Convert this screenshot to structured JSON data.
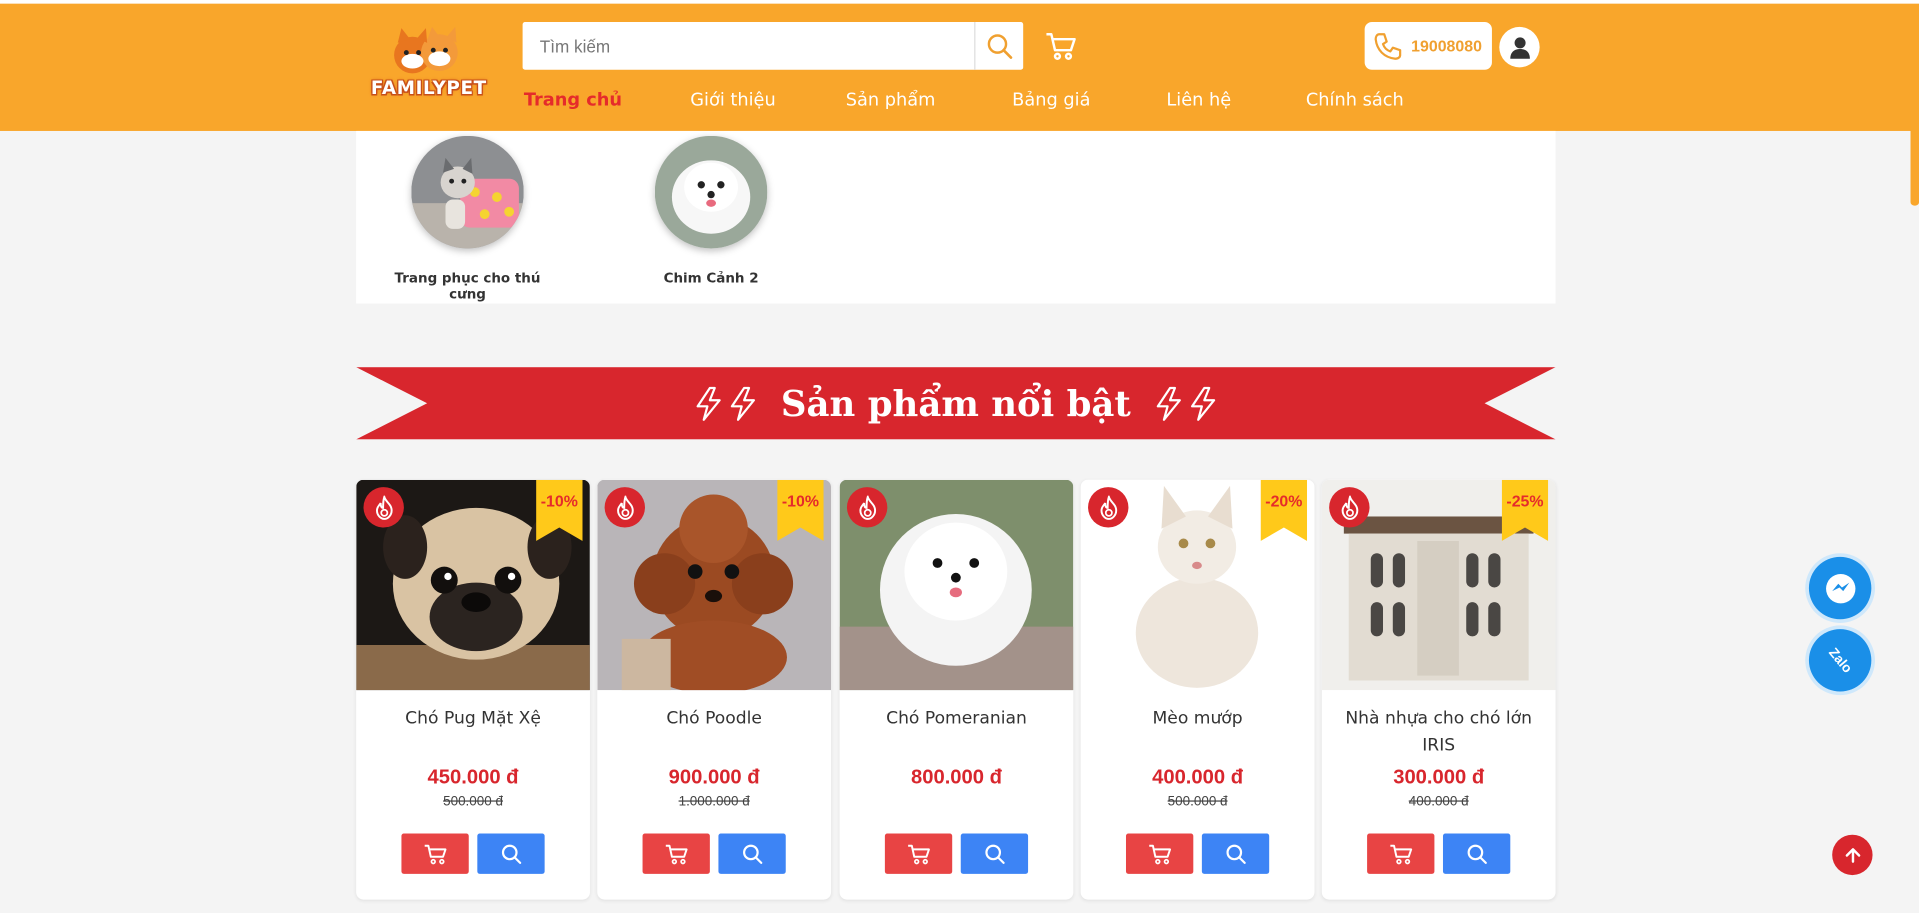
{
  "header": {
    "logo_text": "FAMILYPET",
    "search_placeholder": "Tìm kiếm",
    "phone": "19008080",
    "nav": [
      "Trang chủ",
      "Giới thiệu",
      "Sản phẩm",
      "Bảng giá",
      "Liên hệ",
      "Chính sách"
    ],
    "active_nav": "Trang chủ"
  },
  "categories": [
    {
      "label": "Trang phục cho thú cưng"
    },
    {
      "label": "Chim Cảnh 2"
    }
  ],
  "section": {
    "title": "Sản phẩm nổi bật"
  },
  "products": [
    {
      "name": "Chó Pug Mặt Xệ",
      "price": "450.000 đ",
      "old_price": "500.000 đ",
      "discount": "-10%"
    },
    {
      "name": "Chó Poodle",
      "price": "900.000 đ",
      "old_price": "1.000.000 đ",
      "discount": "-10%"
    },
    {
      "name": "Chó Pomeranian",
      "price": "800.000 đ",
      "old_price": "",
      "discount": ""
    },
    {
      "name": "Mèo mướp",
      "price": "400.000 đ",
      "old_price": "500.000 đ",
      "discount": "-20%"
    },
    {
      "name": "Nhà nhựa cho chó lớn IRIS",
      "price": "300.000 đ",
      "old_price": "400.000 đ",
      "discount": "-25%"
    }
  ],
  "floating": {
    "zalo": "Zalo"
  },
  "colors": {
    "header": "#f9a62b",
    "banner": "#d8262d",
    "price": "#d8262d",
    "cart_button": "#e84444",
    "view_button": "#3d84f5",
    "ribbon": "#ffc91a"
  }
}
